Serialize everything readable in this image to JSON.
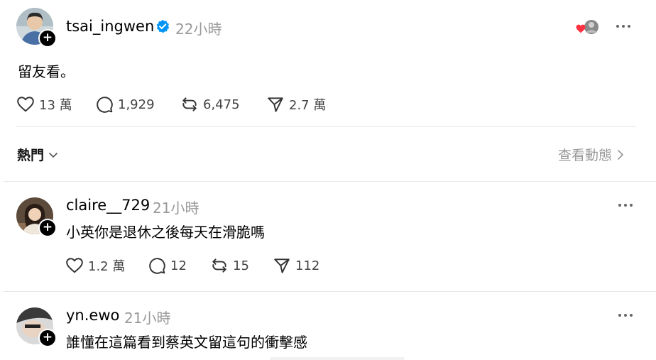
{
  "post": {
    "username": "tsai_ingwen",
    "time": "22小時",
    "text": "留友看。",
    "likes": "13 萬",
    "replies": "1,929",
    "reposts": "6,475",
    "shares": "2.7 萬"
  },
  "sort_bar": {
    "label": "熱門",
    "view_activity": "查看動態"
  },
  "comments": [
    {
      "username": "claire__729",
      "time": "21小時",
      "text": "小英你是退休之後每天在滑脆嗎",
      "likes": "1.2 萬",
      "replies": "12",
      "reposts": "15",
      "shares": "112"
    },
    {
      "username": "yn.ewo",
      "time": "21小時",
      "text": "誰懂在這篇看到蔡英文留這句的衝擊感"
    }
  ],
  "colors": {
    "verified": "#0095f6",
    "like_heart": "#ff3040",
    "muted_text": "#999999",
    "divider": "#e6e6e6"
  }
}
